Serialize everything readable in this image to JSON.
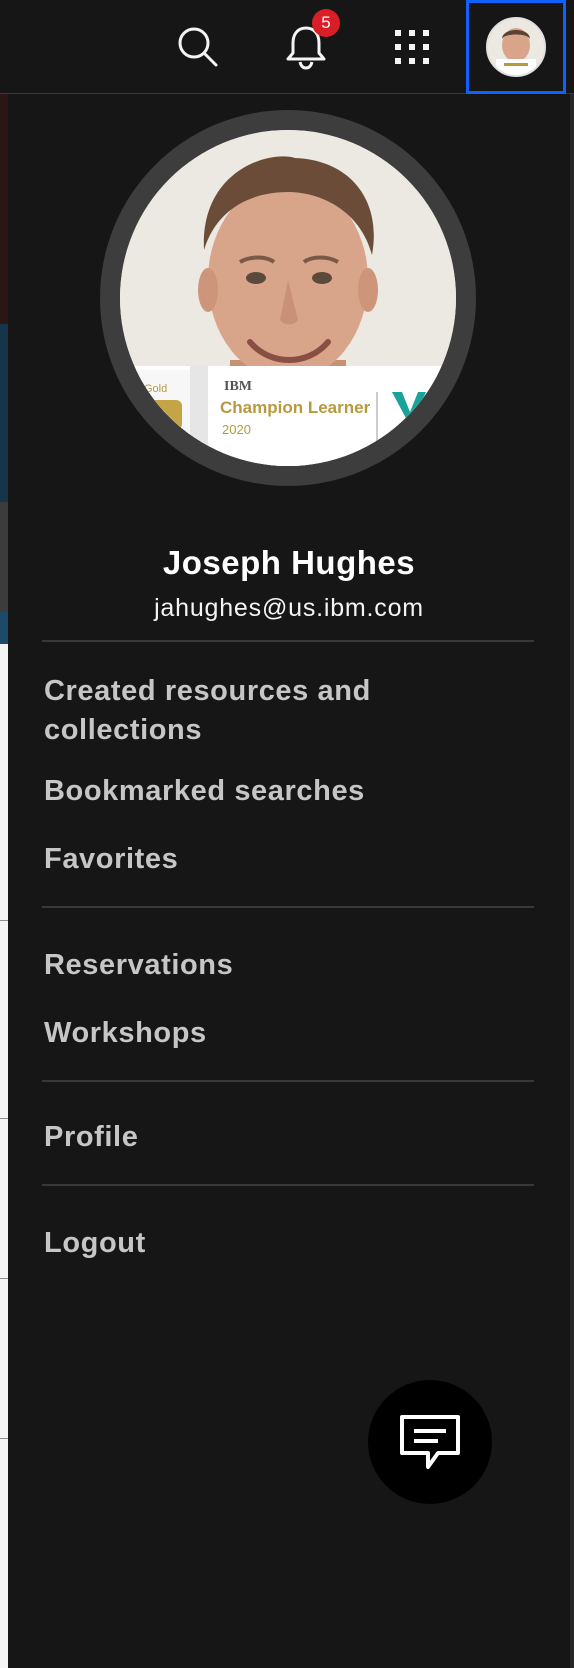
{
  "header": {
    "search_icon": "search-icon",
    "notifications": {
      "icon": "bell-icon",
      "count": "5"
    },
    "apps_icon": "grid-icon",
    "avatar": "user-avatar"
  },
  "profile": {
    "name": "Joseph Hughes",
    "email": "jahughes@us.ibm.com",
    "badge": {
      "level": "Gold",
      "org": "IBM",
      "title": "Champion Learner",
      "year": "2020"
    }
  },
  "menu": {
    "group1": [
      {
        "label": "Created resources and collections"
      },
      {
        "label": "Bookmarked searches"
      },
      {
        "label": "Favorites"
      }
    ],
    "group2": [
      {
        "label": "Reservations"
      },
      {
        "label": "Workshops"
      }
    ],
    "group3": [
      {
        "label": "Profile"
      }
    ],
    "group4": [
      {
        "label": "Logout"
      }
    ]
  },
  "chat": {
    "icon": "chat-icon"
  },
  "colors": {
    "background": "#161616",
    "focus": "#0f62fe",
    "badge": "#da1e28",
    "text_primary": "#ffffff",
    "text_secondary": "#c6c6c6",
    "gold": "#b89a3e"
  }
}
